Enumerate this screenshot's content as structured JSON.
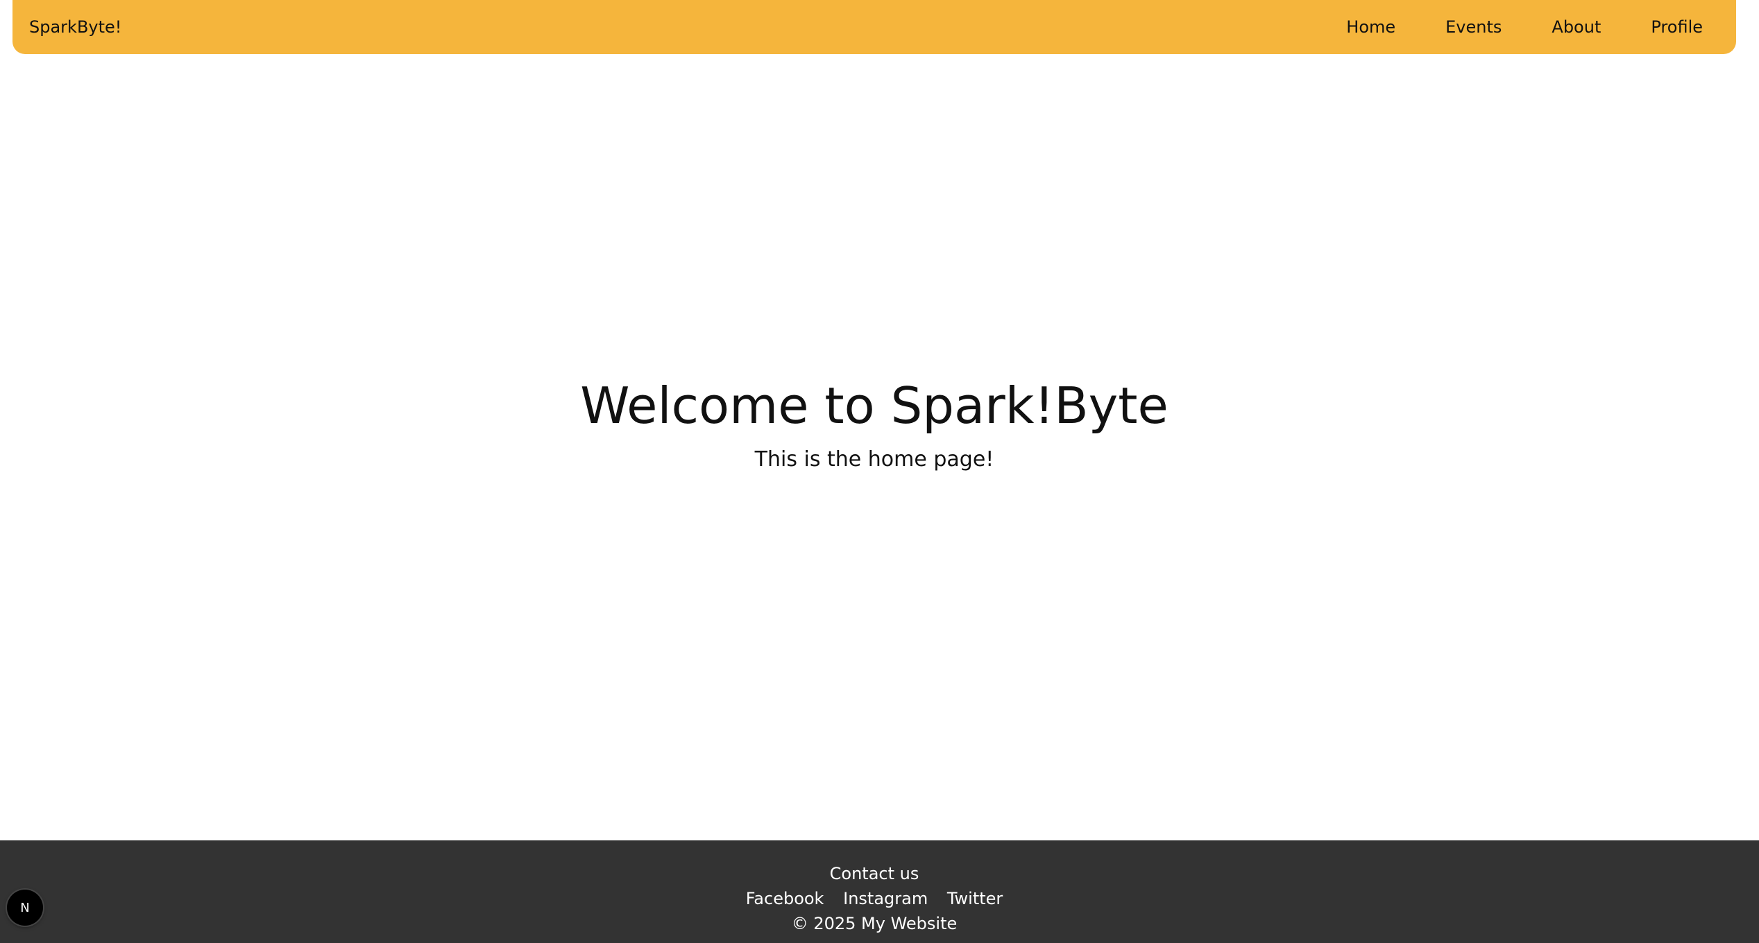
{
  "navbar": {
    "brand": "SparkByte!",
    "links": [
      {
        "label": "Home"
      },
      {
        "label": "Events"
      },
      {
        "label": "About"
      },
      {
        "label": "Profile"
      }
    ]
  },
  "hero": {
    "title": "Welcome to Spark!Byte",
    "subtitle": "This is the home page!"
  },
  "footer": {
    "contact_label": "Contact us",
    "social": [
      {
        "label": "Facebook"
      },
      {
        "label": "Instagram"
      },
      {
        "label": "Twitter"
      }
    ],
    "copyright": "© 2025 My Website"
  },
  "dev_badge": {
    "icon": "nextjs-logo-icon",
    "letter": "N"
  },
  "colors": {
    "navbar_bg": "#F5B53C",
    "footer_bg": "#333333",
    "page_bg": "#FFFFFF",
    "text": "#111111"
  }
}
